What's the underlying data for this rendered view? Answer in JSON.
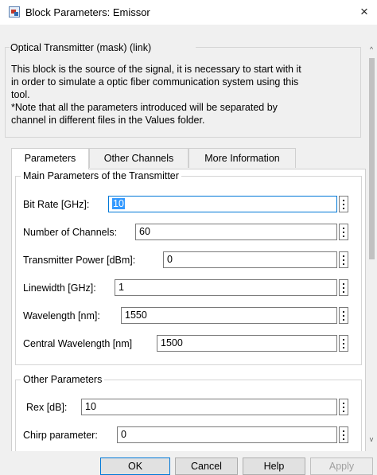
{
  "window": {
    "title": "Block Parameters: Emissor",
    "close_glyph": "×"
  },
  "mask": {
    "title": "Optical Transmitter (mask) (link)",
    "description_lines": [
      "This block is the source of the signal, it is necessary to start with it",
      "in order to simulate a optic fiber communication system using this",
      "tool.",
      "*Note that all the parameters introduced will be separated by",
      "channel in different files in the Values folder."
    ]
  },
  "tabs": [
    {
      "label": "Parameters",
      "active": true
    },
    {
      "label": "Other Channels",
      "active": false
    },
    {
      "label": "More Information",
      "active": false
    }
  ],
  "groups": {
    "main": {
      "title": "Main Parameters of the Transmitter",
      "params": [
        {
          "label": "Bit Rate [GHz]:",
          "value": "10"
        },
        {
          "label": "Number of Channels:",
          "value": "60"
        },
        {
          "label": "Transmitter Power  [dBm]:",
          "value": "0"
        },
        {
          "label": "Linewidth [GHz]:",
          "value": "1"
        },
        {
          "label": "Wavelength [nm]:",
          "value": "1550"
        },
        {
          "label": "Central Wavelength [nm]",
          "value": "1500"
        }
      ]
    },
    "other": {
      "title": "Other Parameters",
      "params": [
        {
          "label": "Rex [dB]:",
          "value": "10"
        },
        {
          "label": "Chirp parameter:",
          "value": "0"
        }
      ]
    }
  },
  "buttons": {
    "ok": "OK",
    "cancel": "Cancel",
    "help": "Help",
    "apply": "Apply"
  },
  "scrollbar": {
    "up_glyph": "^",
    "down_glyph": "v"
  },
  "icons": {
    "app": "block-parameters-icon",
    "menu": "vertical-ellipsis-icon"
  }
}
